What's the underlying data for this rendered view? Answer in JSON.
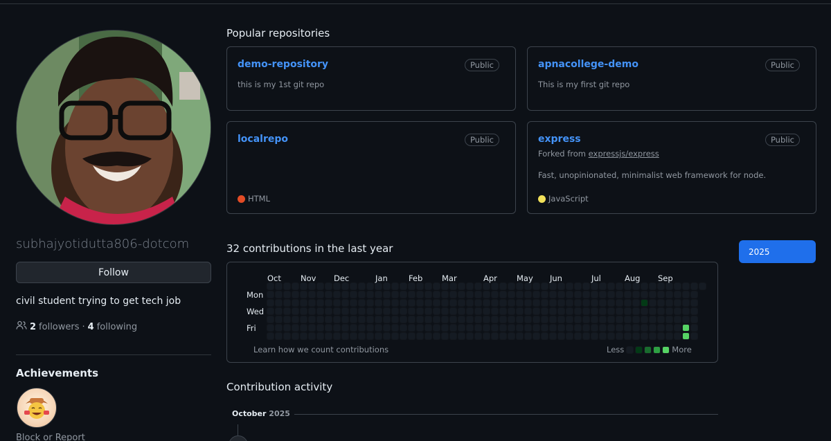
{
  "profile": {
    "username": "subhajyotidutta806-dotcom",
    "follow_label": "Follow",
    "bio": "civil student trying to get tech job",
    "followers_count": "2",
    "followers_label": "followers",
    "separator": "·",
    "following_count": "4",
    "following_label": "following",
    "achievements_title": "Achievements",
    "block_report": "Block or Report"
  },
  "popular": {
    "title": "Popular repositories",
    "repos": [
      {
        "name": "demo-repository",
        "visibility": "Public",
        "description": "this is my 1st git repo"
      },
      {
        "name": "apnacollege-demo",
        "visibility": "Public",
        "description": "This is my first git repo"
      },
      {
        "name": "localrepo",
        "visibility": "Public",
        "language": "HTML",
        "language_color": "#e34c26"
      },
      {
        "name": "express",
        "visibility": "Public",
        "forked_prefix": "Forked from",
        "forked_from": "expressjs/express",
        "description": "Fast, unopinionated, minimalist web framework for node.",
        "language": "JavaScript",
        "language_color": "#f1e05a"
      }
    ]
  },
  "contributions": {
    "title": "32 contributions in the last year",
    "year": "2025",
    "months": [
      "Oct",
      "Nov",
      "Dec",
      "Jan",
      "Feb",
      "Mar",
      "Apr",
      "May",
      "Jun",
      "Jul",
      "Aug",
      "Sep"
    ],
    "days": [
      "Mon",
      "Wed",
      "Fri"
    ],
    "learn_label": "Learn how we count contributions",
    "less_label": "Less",
    "more_label": "More",
    "colors": [
      "#151b23",
      "#033a16",
      "#196c2e",
      "#2ea043",
      "#56d364"
    ]
  },
  "activity": {
    "title": "Contribution activity",
    "month": "October",
    "year": "2025"
  }
}
